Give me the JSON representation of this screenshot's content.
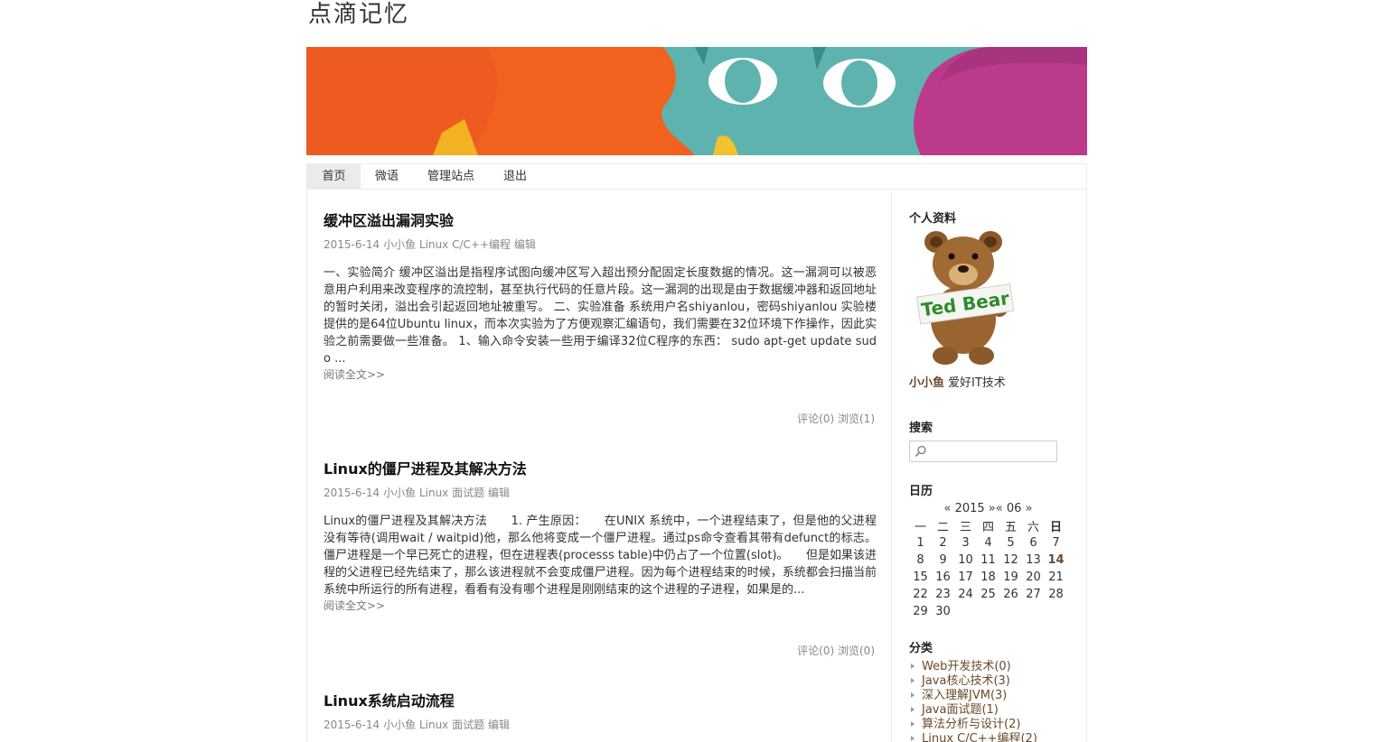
{
  "site": {
    "title": "点滴记忆"
  },
  "nav": [
    {
      "label": "首页"
    },
    {
      "label": "微语"
    },
    {
      "label": "管理站点"
    },
    {
      "label": "退出"
    }
  ],
  "posts": [
    {
      "title": "缓冲区溢出漏洞实验",
      "date": "2015-6-14",
      "author": "小小鱼",
      "category": "Linux C/C++编程",
      "edit": "编辑",
      "excerpt": "一、实验简介 缓冲区溢出是指程序试图向缓冲区写入超出预分配固定长度数据的情况。这一漏洞可以被恶意用户利用来改变程序的流控制，甚至执行代码的任意片段。这一漏洞的出现是由于数据缓冲器和返回地址的暂时关闭，溢出会引起返回地址被重写。 二、实验准备 系统用户名shiyanlou，密码shiyanlou 实验楼提供的是64位Ubuntu linux，而本次实验为了方便观察汇编语句，我们需要在32位环境下作操作，因此实验之前需要做一些准备。 1、输入命令安装一些用于编译32位C程序的东西： sudo apt-get update sudo ...",
      "read_more": "阅读全文>>",
      "comments": "评论(0)",
      "views": "浏览(1)"
    },
    {
      "title": "Linux的僵尸进程及其解决方法",
      "date": "2015-6-14",
      "author": "小小鱼",
      "category": "Linux 面试题",
      "edit": "编辑",
      "excerpt": "Linux的僵尸进程及其解决方法　　1. 产生原因：　　在UNIX 系统中，一个进程结束了，但是他的父进程没有等待(调用wait / waitpid)他，那么他将变成一个僵尸进程。通过ps命令查看其带有defunct的标志。僵尸进程是一个早已死亡的进程，但在进程表(processs table)中仍占了一个位置(slot)。　　但是如果该进程的父进程已经先结束了，那么该进程就不会变成僵尸进程。因为每个进程结束的时候，系统都会扫描当前系统中所运行的所有进程，看看有没有哪个进程是刚刚结束的这个进程的子进程，如果是的...",
      "read_more": "阅读全文>>",
      "comments": "评论(0)",
      "views": "浏览(0)"
    },
    {
      "title": "Linux系统启动流程",
      "date": "2015-6-14",
      "author": "小小鱼",
      "category": "Linux 面试题",
      "edit": "编辑"
    }
  ],
  "sidebar": {
    "profile": {
      "heading": "个人资料",
      "name": "小小鱼",
      "bio": "爱好IT技术",
      "avatar_text": "Ted Bear"
    },
    "search": {
      "heading": "搜索",
      "placeholder": ""
    },
    "calendar": {
      "heading": "日历",
      "prev": "«",
      "year": "2015",
      "month": "06",
      "next": "»",
      "weekdays": [
        "一",
        "二",
        "三",
        "四",
        "五",
        "六",
        "日"
      ],
      "weeks": [
        [
          "1",
          "2",
          "3",
          "4",
          "5",
          "6",
          "7"
        ],
        [
          "8",
          "9",
          "10",
          "11",
          "12",
          "13",
          "14"
        ],
        [
          "15",
          "16",
          "17",
          "18",
          "19",
          "20",
          "21"
        ],
        [
          "22",
          "23",
          "24",
          "25",
          "26",
          "27",
          "28"
        ],
        [
          "29",
          "30",
          "",
          "",
          "",
          "",
          ""
        ]
      ],
      "today": "14"
    },
    "categories": {
      "heading": "分类",
      "items": [
        {
          "label": "Web开发技术(0)"
        },
        {
          "label": "Java核心技术(3)"
        },
        {
          "label": "深入理解JVM(3)"
        },
        {
          "label": "Java面试题(1)"
        },
        {
          "label": "算法分析与设计(2)"
        },
        {
          "label": "Linux C/C++编程(2)"
        }
      ]
    }
  }
}
